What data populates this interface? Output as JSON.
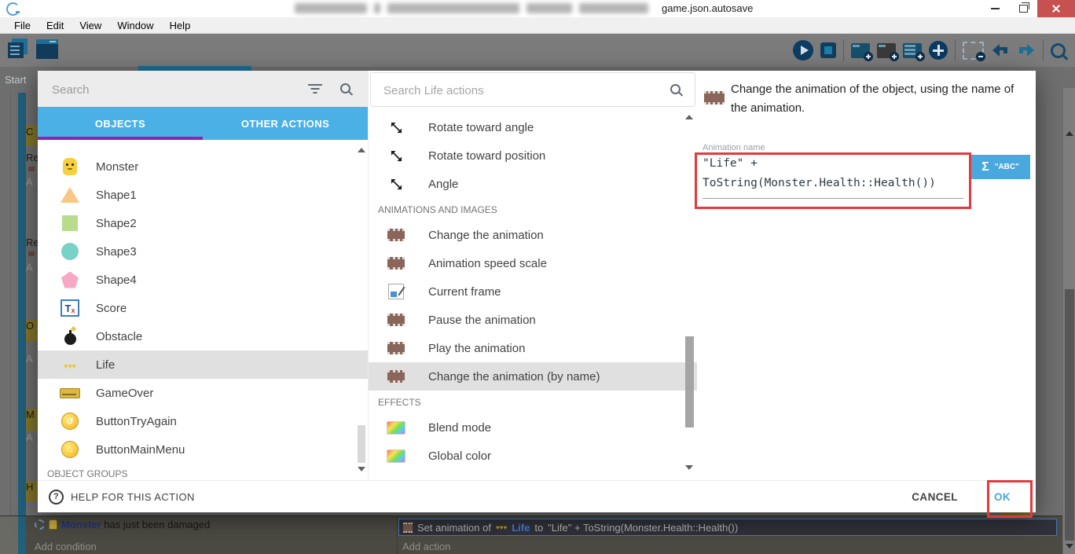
{
  "titlebar": {
    "filename": "game.json.autosave"
  },
  "menubar": {
    "items": [
      "File",
      "Edit",
      "View",
      "Window",
      "Help"
    ]
  },
  "background": {
    "scene_tab_fragment": "Start",
    "left_event_fragments": [
      {
        "text": "C"
      },
      {
        "text": "Re"
      },
      {
        "text": "A"
      },
      {
        "text": "Re"
      },
      {
        "text": "A"
      },
      {
        "text": "O"
      },
      {
        "text": "A"
      },
      {
        "text": "M"
      },
      {
        "text": "A"
      },
      {
        "text": "H"
      }
    ],
    "bottom_event": {
      "condition_object": "Monster",
      "condition_text": "has just been damaged",
      "add_condition": "Add condition",
      "action_prefix": "Set animation of",
      "action_object": "Life",
      "action_connector": "to",
      "action_expression": "\"Life\" + ToString(Monster.Health::Health())",
      "add_action": "Add action"
    }
  },
  "dialog": {
    "objects_panel": {
      "search_placeholder": "Search",
      "tabs": [
        {
          "label": "OBJECTS",
          "active": true
        },
        {
          "label": "OTHER ACTIONS",
          "active": false
        }
      ],
      "items": [
        {
          "label": "Monster"
        },
        {
          "label": "Shape1"
        },
        {
          "label": "Shape2"
        },
        {
          "label": "Shape3"
        },
        {
          "label": "Shape4"
        },
        {
          "label": "Score"
        },
        {
          "label": "Obstacle"
        },
        {
          "label": "Life",
          "selected": true
        },
        {
          "label": "GameOver"
        },
        {
          "label": "ButtonTryAgain"
        },
        {
          "label": "ButtonMainMenu"
        }
      ],
      "section_footer": "OBJECT GROUPS"
    },
    "actions_panel": {
      "search_placeholder": "Search Life actions",
      "rows": [
        {
          "label": "Rotate toward angle",
          "icon": "rotate"
        },
        {
          "label": "Rotate toward position",
          "icon": "rotate"
        },
        {
          "label": "Angle",
          "icon": "rotate"
        },
        {
          "section": "ANIMATIONS AND IMAGES"
        },
        {
          "label": "Change the animation",
          "icon": "film"
        },
        {
          "label": "Animation speed scale",
          "icon": "film"
        },
        {
          "label": "Current frame",
          "icon": "frame"
        },
        {
          "label": "Pause the animation",
          "icon": "film"
        },
        {
          "label": "Play the animation",
          "icon": "film"
        },
        {
          "label": "Change the animation (by name)",
          "icon": "film",
          "selected": true
        },
        {
          "section": "EFFECTS"
        },
        {
          "label": "Blend mode",
          "icon": "rainbow"
        },
        {
          "label": "Global color",
          "icon": "rainbow"
        }
      ]
    },
    "detail_panel": {
      "description": "Change the animation of the object, using the name of the animation.",
      "field_label": "Animation name",
      "field_value": "\"Life\" +\nToString(Monster.Health::Health())",
      "expression_button_sigma": "Σ",
      "expression_button_abc": "\"ABC\""
    },
    "footer": {
      "help_label": "HELP FOR THIS ACTION",
      "cancel_label": "CANCEL",
      "ok_label": "OK"
    }
  },
  "icons": {
    "search": "magnifier",
    "filter": "filter-lines",
    "play": "play-circle",
    "debug": "chip",
    "add_event": "window-plus",
    "add_comment": "comment-plus",
    "add_subevent": "list-plus",
    "add": "plus-circle",
    "remove_event": "window-minus",
    "undo": "bent-arrow-left",
    "redo": "bent-arrow-right",
    "zoom": "magnifier",
    "film": "film-strip",
    "rotate": "diagonal-double-arrow",
    "effect": "rainbow-swatch",
    "frame": "frame-page",
    "help": "question-circle",
    "hearts": "three-hearts",
    "gear": "gear"
  },
  "colors": {
    "accent_blue": "#49a8dd",
    "tab_blue": "#4bb0e6",
    "tab_underline": "#8f23b4",
    "annotation_red": "#e23b3c",
    "close_red": "#c75050",
    "selected_row_bg": "#e0e0e0"
  }
}
